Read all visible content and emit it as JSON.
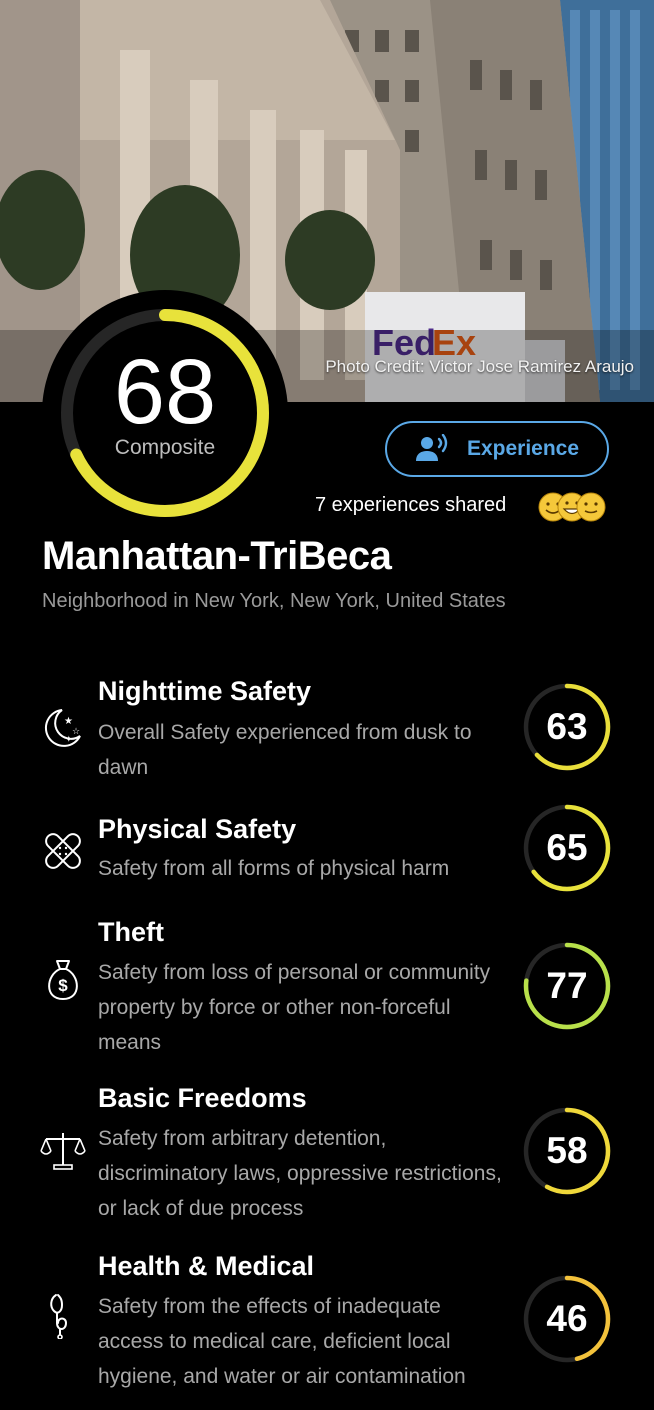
{
  "hero": {
    "photo_credit": "Photo Credit: Victor Jose Ramirez Araujo"
  },
  "composite": {
    "score": "68",
    "label": "Composite",
    "color": "#e8e23b"
  },
  "experience_button": {
    "label": "Experience",
    "icon": "voice-person-icon",
    "color": "#5aa8e6"
  },
  "experiences": {
    "text": "7 experiences shared"
  },
  "location": {
    "title": "Manhattan-TriBeca",
    "subtitle": "Neighborhood in New York, New York, United States"
  },
  "categories": [
    {
      "name": "Nighttime Safety",
      "description": "Overall Safety experienced from dusk to dawn",
      "score": "63",
      "icon": "moon-stars-icon",
      "color": "#e9de3a"
    },
    {
      "name": "Physical Safety",
      "description": "Safety from all forms of physical harm",
      "score": "65",
      "icon": "bandage-icon",
      "color": "#e8e23b"
    },
    {
      "name": "Theft",
      "description": "Safety from loss of personal or community property by force or other non-forceful means",
      "score": "77",
      "icon": "money-bag-icon",
      "color": "#b8e04a"
    },
    {
      "name": "Basic Freedoms",
      "description": "Safety from arbitrary detention, discriminatory laws, oppressive restrictions, or lack of due process",
      "score": "58",
      "icon": "scales-icon",
      "color": "#efd83a"
    },
    {
      "name": "Health & Medical",
      "description": "Safety from the effects of inadequate access to medical care, deficient local hygiene, and water or air contamination",
      "score": "46",
      "icon": "stethoscope-icon",
      "color": "#f3c23b"
    }
  ]
}
